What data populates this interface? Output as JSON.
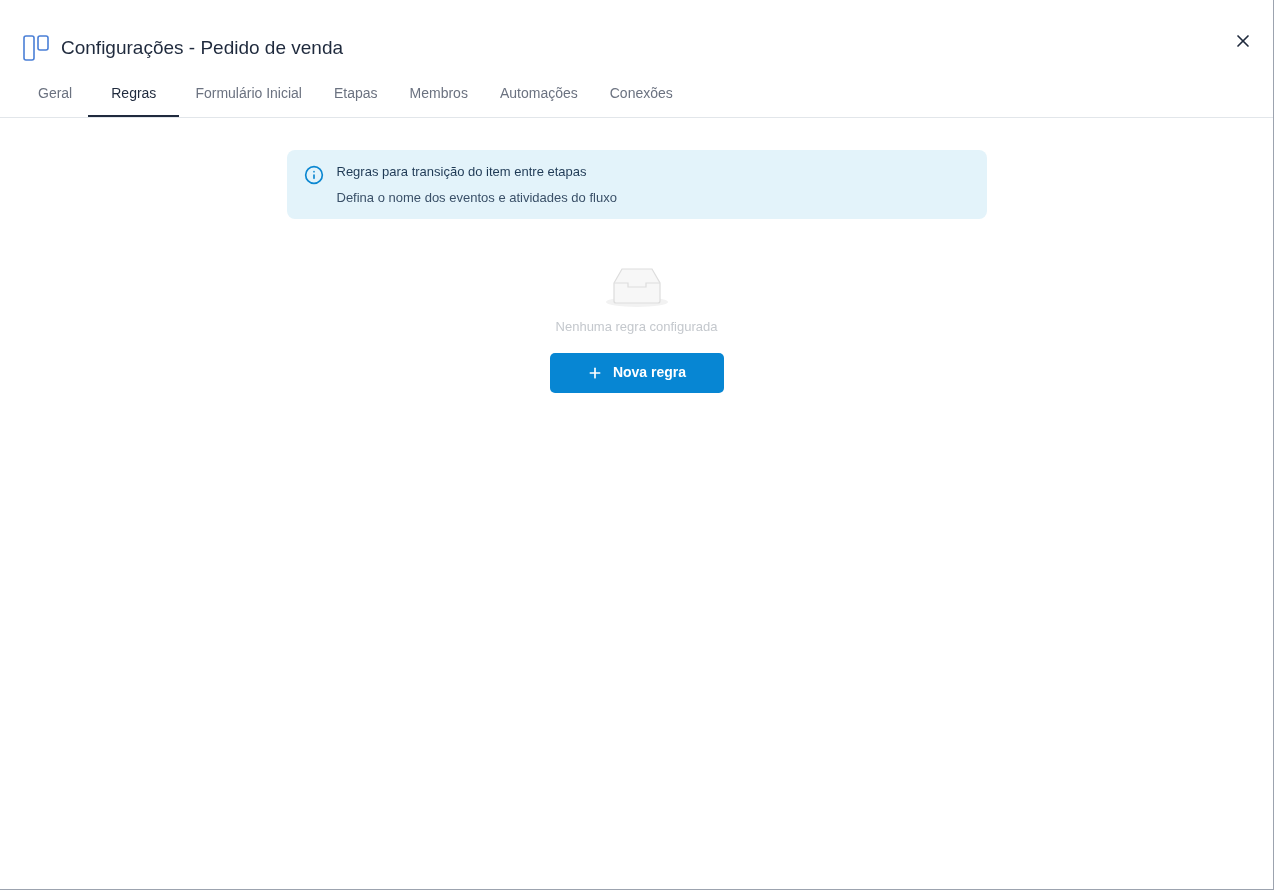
{
  "window": {
    "title": "Configurações - Pedido de venda"
  },
  "tabs": [
    {
      "label": "Geral",
      "selected": false
    },
    {
      "label": "Regras",
      "selected": true
    },
    {
      "label": "Formulário Inicial",
      "selected": false
    },
    {
      "label": "Etapas",
      "selected": false
    },
    {
      "label": "Membros",
      "selected": false
    },
    {
      "label": "Automações",
      "selected": false
    },
    {
      "label": "Conexões",
      "selected": false
    }
  ],
  "info_banner": {
    "title": "Regras para transição do item entre etapas",
    "description": "Defina o nome dos eventos e atividades do fluxo"
  },
  "empty_state": {
    "message": "Nenhuma regra configurada"
  },
  "primary_button": {
    "label": "Nova regra"
  }
}
